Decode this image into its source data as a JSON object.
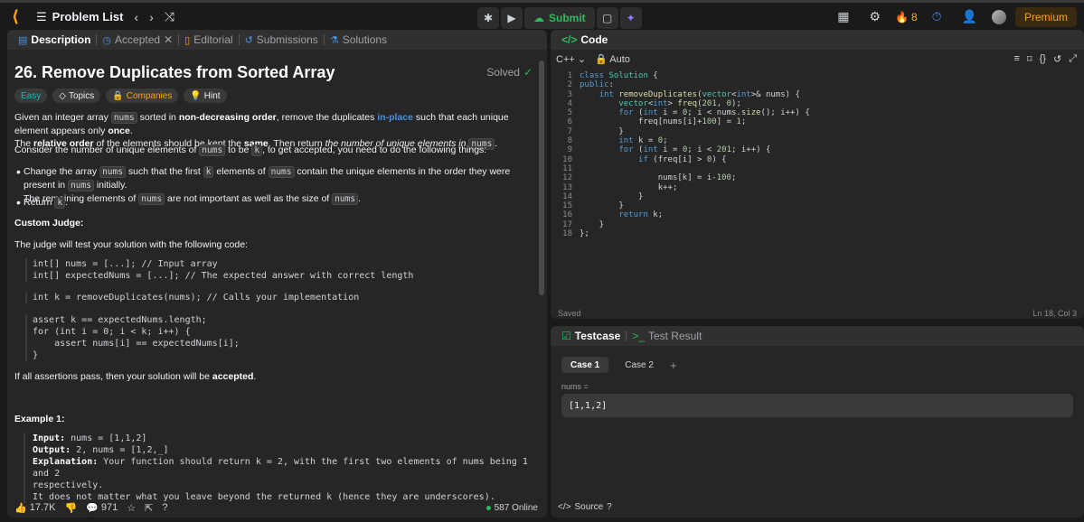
{
  "nav": {
    "logo": "⟨",
    "problem_list": "Problem List",
    "submit": "Submit",
    "streak_count": "8",
    "premium": "Premium"
  },
  "left_tabs": [
    "Description",
    "Accepted",
    "Editorial",
    "Submissions",
    "Solutions"
  ],
  "problem": {
    "title": "26. Remove Duplicates from Sorted Array",
    "status": "Solved",
    "pills": {
      "difficulty": "Easy",
      "topics": "Topics",
      "companies": "Companies",
      "hint": "Hint"
    },
    "p1_a": "Given an integer array ",
    "p1_b": " sorted in ",
    "p1_c": "non-decreasing order",
    "p1_d": ", remove the duplicates ",
    "p1_e": "in-place",
    "p1_f": " such that each unique element appears only ",
    "p1_g": "once",
    "p1_h": ".",
    "p2_a": "The ",
    "p2_b": "relative order",
    "p2_c": " of the elements should be kept the ",
    "p2_d": "same",
    "p2_e": ". Then return ",
    "p2_f": "the number of unique elements in",
    "p2_g": ".",
    "p3_a": "Consider the number of unique elements of ",
    "p3_b": " to be ",
    "p3_c": ", to get accepted, you need to do the following things:",
    "b1_a": "Change the array ",
    "b1_b": " such that the first ",
    "b1_c": " elements of ",
    "b1_d": " contain the unique elements in the order they were present in ",
    "b1_e": " initially.",
    "b1_f": "The remaining elements of ",
    "b1_g": " are not important as well as the size of ",
    "b1_h": ".",
    "b2_a": "Return ",
    "b2_b": ".",
    "code_nums": "nums",
    "code_k": "k",
    "custom_judge": "Custom Judge:",
    "judge_intro": "The judge will test your solution with the following code:",
    "judge_code_1": "int[] nums = [...]; // Input array\nint[] expectedNums = [...]; // The expected answer with correct length",
    "judge_code_2": "int k = removeDuplicates(nums); // Calls your implementation",
    "judge_code_3": "assert k == expectedNums.length;\nfor (int i = 0; i < k; i++) {\n    assert nums[i] == expectedNums[i];\n}",
    "accepted_a": "If all assertions pass, then your solution will be ",
    "accepted_b": "accepted",
    "accepted_c": ".",
    "example_title": "Example 1:",
    "ex_input_label": "Input:",
    "ex_input_value": " nums = [1,1,2]",
    "ex_output_label": "Output:",
    "ex_output_value": " 2, nums = [1,2,_]",
    "ex_expl_label": "Explanation:",
    "ex_expl_value": " Your function should return k = 2, with the first two elements of nums being 1 and 2",
    "ex_expl_2": "respectively.",
    "ex_expl_3": "It does not matter what you leave beyond the returned k (hence they are underscores)."
  },
  "bottom": {
    "likes": "17.7K",
    "comments": "971",
    "online": "587 Online"
  },
  "editor": {
    "tab": "Code",
    "language": "C++",
    "auto": "Auto",
    "saved": "Saved",
    "cursor": "Ln 18, Col 3",
    "lines": [
      {
        "n": "1",
        "t": "class Solution {"
      },
      {
        "n": "2",
        "t": "public:"
      },
      {
        "n": "3",
        "t": "    int removeDuplicates(vector<int>& nums) {"
      },
      {
        "n": "4",
        "t": "        vector<int> freq(201, 0);"
      },
      {
        "n": "5",
        "t": "        for (int i = 0; i < nums.size(); i++) {"
      },
      {
        "n": "6",
        "t": "            freq[nums[i]+100] = 1;"
      },
      {
        "n": "7",
        "t": "        }"
      },
      {
        "n": "8",
        "t": "        int k = 0;"
      },
      {
        "n": "9",
        "t": "        for (int i = 0; i < 201; i++) {"
      },
      {
        "n": "10",
        "t": "            if (freq[i] > 0) {"
      },
      {
        "n": "11",
        "t": ""
      },
      {
        "n": "12",
        "t": "                nums[k] = i-100;"
      },
      {
        "n": "13",
        "t": "                k++;"
      },
      {
        "n": "14",
        "t": "            }"
      },
      {
        "n": "15",
        "t": "        }"
      },
      {
        "n": "16",
        "t": "        return k;"
      },
      {
        "n": "17",
        "t": "    }"
      },
      {
        "n": "18",
        "t": "};"
      }
    ]
  },
  "testcase": {
    "tab_testcase": "Testcase",
    "tab_result": "Test Result",
    "case1": "Case 1",
    "case2": "Case 2",
    "add": "+",
    "var_label": "nums =",
    "var_value": "[1,1,2]",
    "source": "Source"
  }
}
